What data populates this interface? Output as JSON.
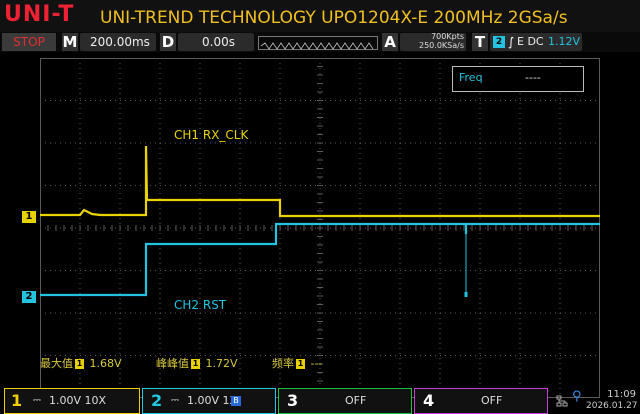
{
  "header": {
    "logo": "UNI-T",
    "model": "UNI-TREND TECHNOLOGY UPO1204X-E 200MHz 2GSa/s"
  },
  "status": {
    "run_state": "STOP",
    "m_label": "M",
    "timebase": "200.00ms",
    "d_label": "D",
    "delay": "0.00s",
    "a_label": "A",
    "memory_depth": "700Kpts",
    "sample_rate": "250.0KSa/s",
    "t_label": "T",
    "trigger_source": "2",
    "trigger_mode": "E DC",
    "trigger_level": "1.12V"
  },
  "measure_box": {
    "label": "Freq",
    "value": "----"
  },
  "labels": {
    "ch1_name": "CH1 RX_CLK",
    "ch2_name": "CH2 RST"
  },
  "channel_markers": {
    "ch1": "1",
    "ch2": "2"
  },
  "measurements": [
    {
      "label": "最大值",
      "source": "1",
      "value": "1.68V"
    },
    {
      "label": "峰峰值",
      "source": "1",
      "value": "1.72V"
    },
    {
      "label": "频率",
      "source": "1",
      "value": "---"
    }
  ],
  "channels": [
    {
      "num": "1",
      "scale": "1.00V 10X",
      "color": "#f0d000"
    },
    {
      "num": "2",
      "scale": "1.00V 1X",
      "flag": "B",
      "color": "#20c8e0"
    },
    {
      "num": "3",
      "scale": "OFF",
      "color": "#20c040"
    },
    {
      "num": "4",
      "scale": "OFF",
      "color": "#c040d0"
    }
  ],
  "clock": {
    "time": "11:09",
    "date": "2026.01.27"
  },
  "colors": {
    "ch1": "#e8d200",
    "ch2": "#22c4e0",
    "grid": "#5a5a5a",
    "stop": "#e03030"
  }
}
